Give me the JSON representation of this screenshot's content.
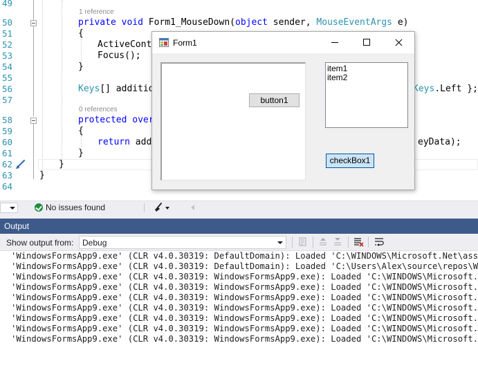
{
  "editor": {
    "lines": [
      {
        "num": "49",
        "text": ""
      },
      {
        "num": "50",
        "text": ""
      },
      {
        "num": "51",
        "text": "{"
      },
      {
        "num": "52",
        "text": "ActiveContro"
      },
      {
        "num": "53",
        "text": "Focus();"
      },
      {
        "num": "54",
        "text": "}"
      },
      {
        "num": "55",
        "text": ""
      },
      {
        "num": "56",
        "text": ""
      },
      {
        "num": "57",
        "text": ""
      },
      {
        "num": "58",
        "text": ""
      },
      {
        "num": "59",
        "text": "{"
      },
      {
        "num": "60",
        "text": ""
      },
      {
        "num": "61",
        "text": "}"
      },
      {
        "num": "62",
        "text": "}"
      },
      {
        "num": "63",
        "text": "}"
      },
      {
        "num": "64",
        "text": ""
      }
    ],
    "ref_1": "1 reference",
    "ref_0": "0 references",
    "l50": {
      "kw1": "private",
      "kw2": "void",
      "name": "Form1_MouseDown(",
      "kw3": "object",
      "p1": " sender, ",
      "ty": "MouseEventArgs",
      "p2": " e)"
    },
    "l56": {
      "ty1": "Keys",
      "rest": "[] additio",
      "ty2": "Keys",
      "tail": ".Left };"
    },
    "l58": {
      "kw1": "protected",
      "kw2": "overr"
    },
    "l60": {
      "kw": "return",
      "rest": " addi",
      "tail": "eyData);"
    }
  },
  "status": {
    "issues": "No issues found"
  },
  "output": {
    "title": "Output",
    "show_label": "Show output from:",
    "source": "Debug",
    "lines": [
      "'WindowsFormsApp9.exe' (CLR v4.0.30319: DefaultDomain): Loaded 'C:\\WINDOWS\\Microsoft.Net\\assembly",
      "'WindowsFormsApp9.exe' (CLR v4.0.30319: DefaultDomain): Loaded 'C:\\Users\\Alex\\source\\repos\\Window",
      "'WindowsFormsApp9.exe' (CLR v4.0.30319: WindowsFormsApp9.exe): Loaded 'C:\\WINDOWS\\Microsoft.Net\\a",
      "'WindowsFormsApp9.exe' (CLR v4.0.30319: WindowsFormsApp9.exe): Loaded 'C:\\WINDOWS\\Microsoft.Net\\a",
      "'WindowsFormsApp9.exe' (CLR v4.0.30319: WindowsFormsApp9.exe): Loaded 'C:\\WINDOWS\\Microsoft.Net\\a",
      "'WindowsFormsApp9.exe' (CLR v4.0.30319: WindowsFormsApp9.exe): Loaded 'C:\\WINDOWS\\Microsoft.Net\\a",
      "'WindowsFormsApp9.exe' (CLR v4.0.30319: WindowsFormsApp9.exe): Loaded 'C:\\WINDOWS\\Microsoft.Net\\a",
      "'WindowsFormsApp9.exe' (CLR v4.0.30319: WindowsFormsApp9.exe): Loaded 'C:\\WINDOWS\\Microsoft.Net\\a",
      "'WindowsFormsApp9.exe' (CLR v4.0.30319: WindowsFormsApp9.exe): Loaded 'C:\\WINDOWS\\Microsoft.Net\\a"
    ]
  },
  "form": {
    "title": "Form1",
    "button_label": "button1",
    "list_items": [
      "item1",
      "item2"
    ],
    "checkbox_label": "checkBox1"
  },
  "colors": {
    "keyword": "#0000ff",
    "type": "#2b91af",
    "output_title_bg": "#3d5a8a",
    "checkbox_bg": "#cce4f7"
  },
  "icons": [
    "fold-toggle-icon",
    "paintbrush-icon",
    "check-circle-icon",
    "code-cleanup-icon",
    "nav-left-icon",
    "form-app-icon",
    "minimize-icon",
    "maximize-icon",
    "close-icon",
    "find-message-icon",
    "prev-message-icon",
    "next-message-icon",
    "clear-all-icon",
    "word-wrap-icon"
  ]
}
